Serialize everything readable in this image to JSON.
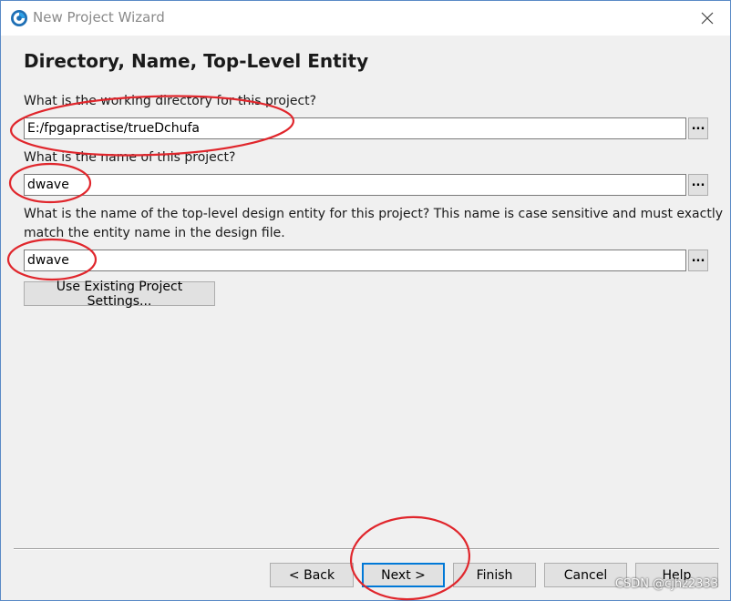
{
  "window": {
    "title": "New Project Wizard"
  },
  "page": {
    "title": "Directory, Name, Top-Level Entity"
  },
  "fields": {
    "directory": {
      "label": "What is the working directory for this project?",
      "value": "E:/fpgapractise/trueDchufa",
      "browse_label": "..."
    },
    "name": {
      "label": "What is the name of this project?",
      "value": "dwave",
      "browse_label": "..."
    },
    "entity": {
      "label_line1": "What is the name of the top-level design entity for this project? This name is case sensitive and must exactly",
      "label_line2": "match the entity name in the design file.",
      "value": "dwave",
      "browse_label": "..."
    }
  },
  "existing_settings_button": "Use Existing Project Settings...",
  "footer": {
    "back": "< Back",
    "next": "Next >",
    "finish": "Finish",
    "cancel": "Cancel",
    "help": "Help"
  },
  "watermark": "CSDN @cjhz2333",
  "colors": {
    "annotation": "#e0262c",
    "default_button_border": "#0078d7"
  },
  "icons": {
    "app": "quartus-logo-icon",
    "close": "close-icon"
  }
}
